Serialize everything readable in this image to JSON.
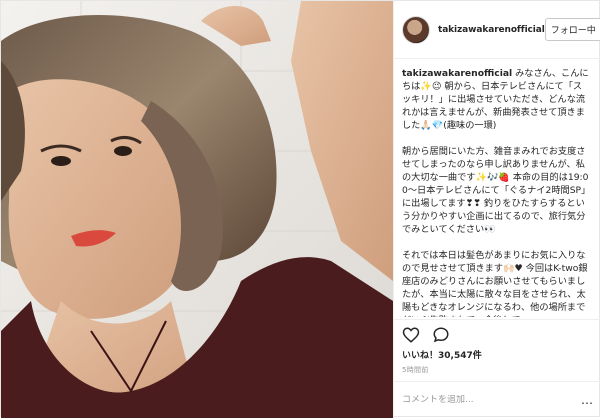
{
  "post": {
    "username": "takizawakarenofficial",
    "follow_label": "フォロー中",
    "caption": [
      "みなさん、こんにちは✨😉 朝から、日本テレビさんにて「スッキリ！」に出場させていただき、どんな流れかは言えませんが、新曲発表させて頂きました🙏🏻💎(趣味の一環)",
      "朝から居間にいた方、雑音まみれでお支度させてしまったのなら申し訳ありませんが、私の大切な一曲です✨🎶🍓 本命の目的は19:00〜日本テレビさんにて「ぐるナイ2時間SP」に出場してます❣❣ 釣りをひたすらするという分かりやすい企画に出てるので、旅行気分でみといてください👀",
      "それでは本日は髪色があまりにお気に入りなので見せさせて頂きます🙌🏻♥ 今回はK-two銀座店のみどりさんにお願いさせてもらいましたが、本当に太陽に散々な目をさせられ、太陽もどきなオレンジになるわ、他の場所までだいぶ失敗されて、今後して"
    ],
    "likes_label": "いいね！30,547件",
    "time_label": "5時間前",
    "comment_placeholder": "コメントを追加...",
    "more_label": "…"
  },
  "icons": [
    "heart-icon",
    "comment-icon"
  ],
  "colors": {
    "border": "#efefef",
    "text": "#262626",
    "muted": "#999999",
    "lip": "#d9493e",
    "dress": "#4a1c1e"
  }
}
